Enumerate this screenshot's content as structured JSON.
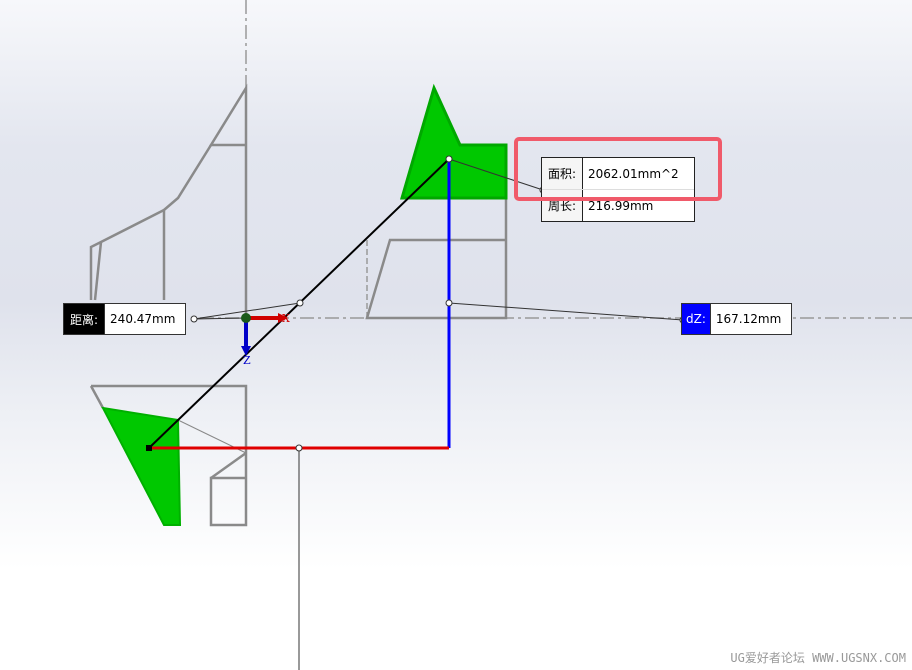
{
  "measurements": {
    "area_label": "面积:",
    "area_value": "2062.01mm^2",
    "perimeter_label": "周长:",
    "perimeter_value": "216.99mm",
    "distance_label": "距离:",
    "distance_value": "240.47mm",
    "dz_label": "dZ:",
    "dz_value": "167.12mm"
  },
  "axes": {
    "x_label": "X",
    "z_label": "Z"
  },
  "watermark": "UG爱好者论坛 WWW.UGSNX.COM",
  "colors": {
    "face": "#00c800",
    "highlight": "#f05a6a",
    "dz": "#0000ff",
    "x_axis": "#d00000",
    "z_axis": "#0000c8"
  }
}
